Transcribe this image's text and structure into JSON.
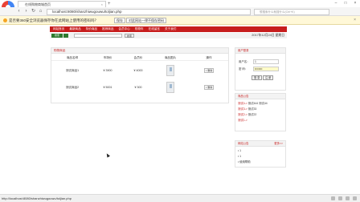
{
  "browser": {
    "tab_title": "在线购物商城首页",
    "url": "localhost:8080/shanzhiwugouwu/toljian.php",
    "search_placeholder": "想搜索什么就搜什么(Ctrl+K)",
    "new_tab_icon": "plus-icon"
  },
  "notification": {
    "text": "是否要360安全浏览器保存你在此网站上使用的密码吗？",
    "save_label": "保存",
    "never_label": "对此网站一律不保存密码"
  },
  "site": {
    "nav_items": [
      "网站首页",
      "最新商品",
      "特价商品",
      "推荐商品",
      "会员中心",
      "购物车",
      "在线留言",
      "关于我们"
    ],
    "search_button": "搜索",
    "search_go": "搜索",
    "date_text": "2017年12月24日 星期日"
  },
  "cart": {
    "panel_title": "购物商品",
    "columns": [
      "商品名称",
      "市场价",
      "会员价",
      "商品图片",
      "操作"
    ],
    "rows": [
      {
        "name": "测试商品1",
        "market_price": "¥ 3900",
        "member_price": "¥ 4000",
        "action": "× 删除"
      },
      {
        "name": "测试商品2",
        "market_price": "¥ 5001",
        "member_price": "¥ 300",
        "action": "× 删除"
      }
    ]
  },
  "login": {
    "panel_title": "用户登录",
    "user_label": "用户名：",
    "user_value": "1",
    "pass_label": "密 码：",
    "pass_value": "••••••••",
    "login_button": "登 录",
    "register_button": "注 册"
  },
  "announcements": {
    "panel_title": "商品公告",
    "items": [
      {
        "prefix": "测试4->",
        "rest": " 测试444 测试44"
      },
      {
        "prefix": "测试3->",
        "rest": " 测试33"
      },
      {
        "prefix": "测试2->",
        "rest": " 测试22"
      },
      {
        "prefix": "测试1->",
        "rest": ""
      }
    ]
  },
  "help": {
    "panel_title": "网站公告",
    "more_label": "更多>>",
    "items": [
      "• 1",
      "• 1",
      "• 使用帮助"
    ]
  },
  "status": {
    "url": "http://localhost:8080/shanzhiwugouwu/toljian.php"
  }
}
